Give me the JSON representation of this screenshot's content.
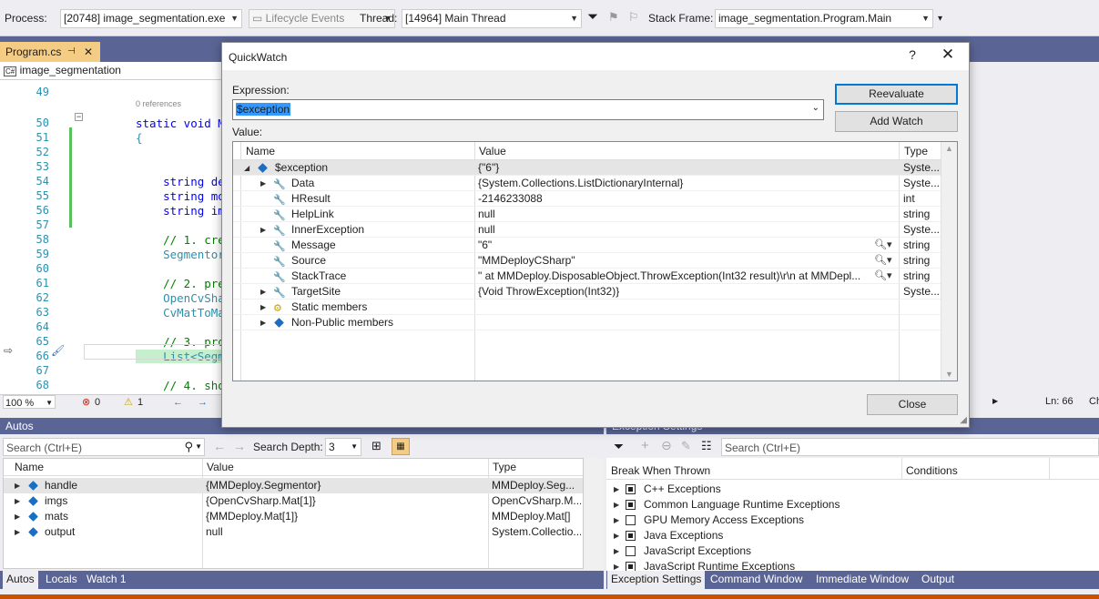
{
  "toolbar": {
    "process_label": "Process:",
    "process_value": "[20748] image_segmentation.exe",
    "lifecycle_label": "Lifecycle Events",
    "thread_label": "Thread:",
    "thread_value": "[14964] Main Thread",
    "stack_label": "Stack Frame:",
    "stack_value": "image_segmentation.Program.Main"
  },
  "doc_tab": {
    "label": "Program.cs",
    "pin_icon": "pin-icon",
    "close_icon": "close-icon"
  },
  "navbar": {
    "badge": "C#",
    "project": "image_segmentation"
  },
  "editor": {
    "refs_label": "0 references",
    "lines": [
      {
        "n": "49",
        "code": ""
      },
      {
        "n": "50",
        "code": "static void M"
      },
      {
        "n": "51",
        "code": "{"
      },
      {
        "n": "52",
        "code": ""
      },
      {
        "n": "53",
        "code": ""
      },
      {
        "n": "54",
        "code": "    string de"
      },
      {
        "n": "55",
        "code": "    string mo"
      },
      {
        "n": "56",
        "code": "    string im"
      },
      {
        "n": "57",
        "code": ""
      },
      {
        "n": "58",
        "code": "    // 1. cre"
      },
      {
        "n": "59",
        "code": "    Segmentor"
      },
      {
        "n": "60",
        "code": ""
      },
      {
        "n": "61",
        "code": "    // 2. pre"
      },
      {
        "n": "62",
        "code": "    OpenCvShar"
      },
      {
        "n": "63",
        "code": "    CvMatToMa"
      },
      {
        "n": "64",
        "code": ""
      },
      {
        "n": "65",
        "code": "    // 3. pro"
      },
      {
        "n": "66",
        "code": "    List<Segme"
      },
      {
        "n": "67",
        "code": ""
      },
      {
        "n": "68",
        "code": "    // 4. sho"
      }
    ]
  },
  "editor_status": {
    "zoom": "100 %",
    "errors": "0",
    "warnings": "1",
    "position": "Ln: 66",
    "col_partial": "Ch"
  },
  "quickwatch": {
    "title": "QuickWatch",
    "help": "?",
    "expression_label": "Expression:",
    "expression_value": "$exception",
    "value_label": "Value:",
    "reevaluate": "Reevaluate",
    "add_watch": "Add Watch",
    "close": "Close",
    "columns": {
      "name": "Name",
      "value": "Value",
      "type": "Type"
    },
    "rows": [
      {
        "name": "$exception",
        "value": "{\"6\"}",
        "type": "Syste...",
        "indent": 0,
        "expand": "open",
        "icon": "object"
      },
      {
        "name": "Data",
        "value": "{System.Collections.ListDictionaryInternal}",
        "type": "Syste...",
        "indent": 1,
        "expand": "closed",
        "icon": "wrench"
      },
      {
        "name": "HResult",
        "value": "-2146233088",
        "type": "int",
        "indent": 1,
        "expand": "none",
        "icon": "wrench"
      },
      {
        "name": "HelpLink",
        "value": "null",
        "type": "string",
        "indent": 1,
        "expand": "none",
        "icon": "wrench"
      },
      {
        "name": "InnerException",
        "value": "null",
        "type": "Syste...",
        "indent": 1,
        "expand": "closed",
        "icon": "wrench"
      },
      {
        "name": "Message",
        "value": "\"6\"",
        "type": "string",
        "indent": 1,
        "expand": "none",
        "icon": "wrench",
        "viz": true
      },
      {
        "name": "Source",
        "value": "\"MMDeployCSharp\"",
        "type": "string",
        "indent": 1,
        "expand": "none",
        "icon": "wrench",
        "viz": true
      },
      {
        "name": "StackTrace",
        "value": "\"   at MMDeploy.DisposableObject.ThrowException(Int32 result)\\r\\n   at MMDepl...",
        "type": "string",
        "indent": 1,
        "expand": "none",
        "icon": "wrench",
        "viz": true
      },
      {
        "name": "TargetSite",
        "value": "{Void ThrowException(Int32)}",
        "type": "Syste...",
        "indent": 1,
        "expand": "closed",
        "icon": "wrench"
      },
      {
        "name": "Static members",
        "value": "",
        "type": "",
        "indent": 1,
        "expand": "closed",
        "icon": "static"
      },
      {
        "name": "Non-Public members",
        "value": "",
        "type": "",
        "indent": 1,
        "expand": "closed",
        "icon": "object"
      }
    ]
  },
  "autos": {
    "title": "Autos",
    "search_placeholder": "Search (Ctrl+E)",
    "depth_label": "Search Depth:",
    "depth_value": "3",
    "columns": {
      "name": "Name",
      "value": "Value",
      "type": "Type"
    },
    "rows": [
      {
        "name": "handle",
        "value": "{MMDeploy.Segmentor}",
        "type": "MMDeploy.Seg..."
      },
      {
        "name": "imgs",
        "value": "{OpenCvSharp.Mat[1]}",
        "type": "OpenCvSharp.M..."
      },
      {
        "name": "mats",
        "value": "{MMDeploy.Mat[1]}",
        "type": "MMDeploy.Mat[]"
      },
      {
        "name": "output",
        "value": "null",
        "type": "System.Collectio..."
      }
    ],
    "tabs": [
      "Autos",
      "Locals",
      "Watch 1"
    ]
  },
  "exceptions": {
    "title": "Exception Settings",
    "search_placeholder": "Search (Ctrl+E)",
    "col_break": "Break When Thrown",
    "col_conditions": "Conditions",
    "rows": [
      {
        "label": "C++ Exceptions",
        "state": "partial"
      },
      {
        "label": "Common Language Runtime Exceptions",
        "state": "partial"
      },
      {
        "label": "GPU Memory Access Exceptions",
        "state": "off"
      },
      {
        "label": "Java Exceptions",
        "state": "partial"
      },
      {
        "label": "JavaScript Exceptions",
        "state": "off"
      },
      {
        "label": "JavaScript Runtime Exceptions",
        "state": "partial"
      }
    ],
    "tabs": [
      "Exception Settings",
      "Command Window",
      "Immediate Window",
      "Output"
    ]
  },
  "colors": {
    "accent": "#5a6595",
    "doc_tab": "#f5cc84",
    "selection": "#3399ff",
    "status_strip": "#ca5100"
  }
}
